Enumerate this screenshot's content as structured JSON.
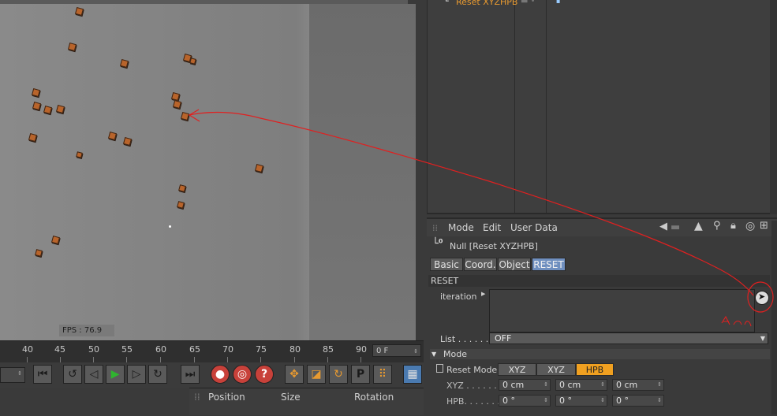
{
  "viewport": {
    "fps": "FPS : 76.9"
  },
  "timeline": {
    "ticks": [
      "40",
      "45",
      "50",
      "55",
      "60",
      "65",
      "70",
      "75",
      "80",
      "85",
      "90"
    ],
    "frame": "0 F"
  },
  "coord_manager": {
    "position": "Position",
    "size": "Size",
    "rotation": "Rotation"
  },
  "object_manager": {
    "object_label": "Reset XYZHPB"
  },
  "attributes": {
    "menu": [
      "Mode",
      "Edit",
      "User Data"
    ],
    "object_title": "Null [Reset XYZHPB]",
    "tabs": [
      "Basic",
      "Coord.",
      "Object",
      "RESET"
    ],
    "active_tab": "RESET",
    "section": "RESET",
    "iteration_label": "iteration",
    "list_label": "List . . . . . .",
    "list_value": "OFF",
    "mode_header": "Mode",
    "reset_mode_label": "Reset Mode",
    "reset_modes": [
      "XYZ HPB",
      "XYZ",
      "HPB"
    ],
    "active_reset_mode": "HPB",
    "xyz_label": "XYZ . . . . . . .",
    "xyz_values": [
      "0 cm",
      "0 cm",
      "0 cm"
    ],
    "hpb_label": "HPB. . . . . . .",
    "hpb_values": [
      "0 °",
      "0 °",
      "0 °"
    ]
  },
  "colors": {
    "accent_orange": "#f0a020",
    "active_tab_blue": "#6f8fbf",
    "annotation_red": "#e02020"
  }
}
